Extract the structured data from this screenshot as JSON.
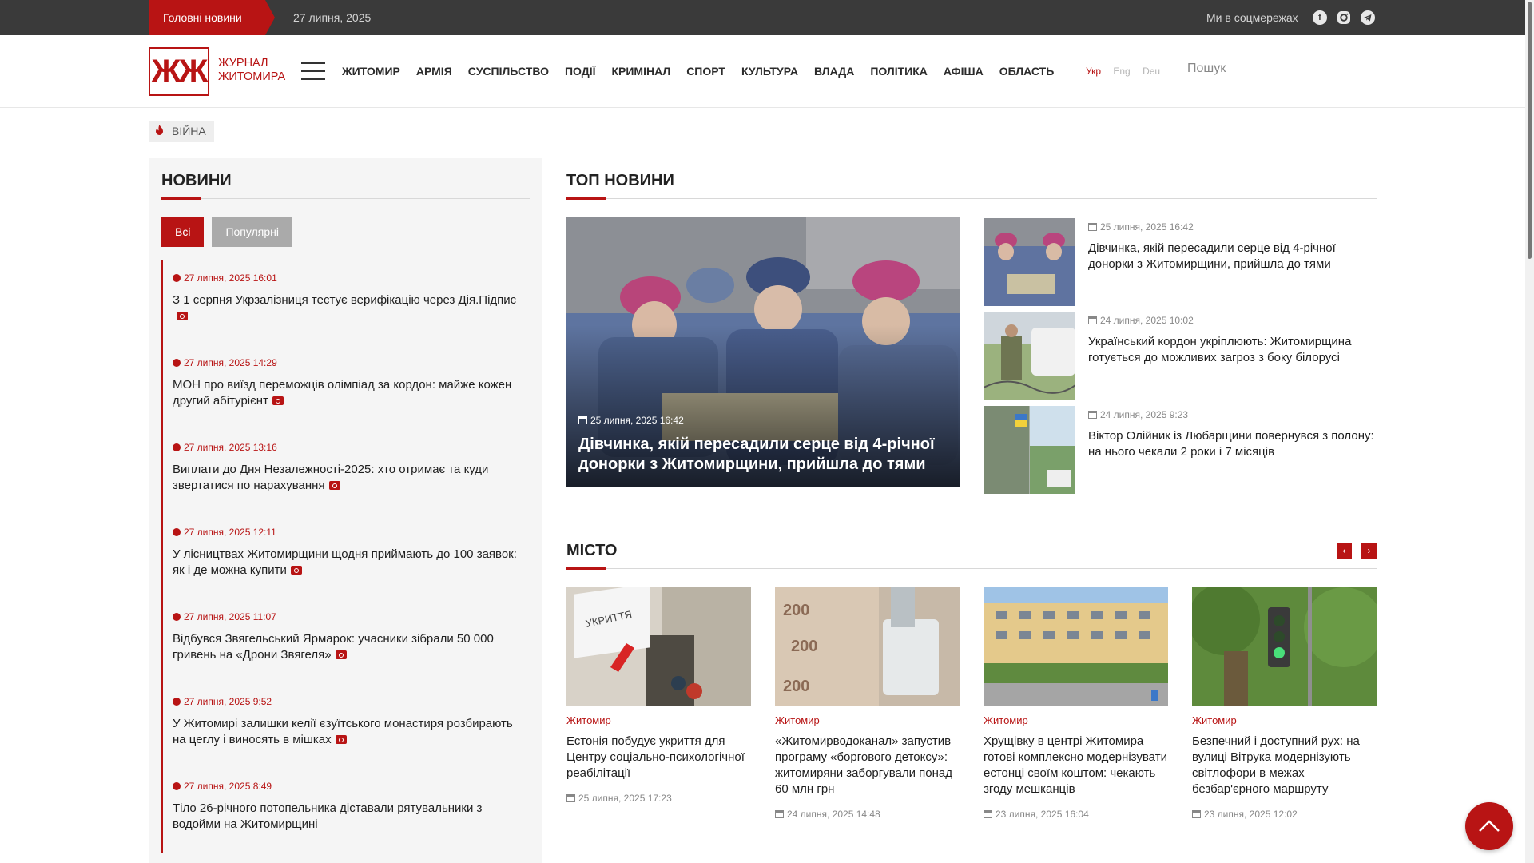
{
  "topbar": {
    "hot_label": "Головні новини",
    "date": "27 липня, 2025",
    "social_label": "Ми в соцмережах",
    "social_icons": [
      "facebook-icon",
      "instagram-icon",
      "telegram-icon"
    ]
  },
  "header": {
    "logo_mark": "ЖЖ",
    "logo_line1": "ЖУРНАЛ",
    "logo_line2": "ЖИТОМИРА",
    "nav": [
      "ЖИТОМИР",
      "АРМІЯ",
      "СУСПІЛЬСТВО",
      "ПОДІЇ",
      "КРИМІНАЛ",
      "СПОРТ",
      "КУЛЬТУРА",
      "ВЛАДА",
      "ПОЛІТИКА",
      "АФІША",
      "ОБЛАСТЬ"
    ],
    "langs": [
      "Укр",
      "Eng",
      "Deu"
    ],
    "search_placeholder": "Пошук"
  },
  "tag": {
    "label": "ВІЙНА"
  },
  "news_panel": {
    "title": "НОВИНИ",
    "tab_all": "Всі",
    "tab_popular": "Популярні",
    "items": [
      {
        "time": "27 липня, 2025 16:01",
        "title": "З 1 серпня Укрзалізниця тестує верифікацію через Дія.Підпис"
      },
      {
        "time": "27 липня, 2025 14:29",
        "title": "МОН про виїзд переможців олімпіад за кордон: майже кожен другий абітурієнт"
      },
      {
        "time": "27 липня, 2025 13:16",
        "title": "Виплати до Дня Незалежності-2025: хто отримає та куди звертатися по нарахування"
      },
      {
        "time": "27 липня, 2025 12:11",
        "title": "У лісництвах Житомирщини щодня приймають до 100 заявок: як і де можна купити"
      },
      {
        "time": "27 липня, 2025 11:07",
        "title": "Відбувся Звягельський Ярмарок: учасники зібрали 50 000 гривень на «Дрони Звягеля»"
      },
      {
        "time": "27 липня, 2025 9:52",
        "title": "У Житомирі залишки келії єзуїтського монастиря розбирають на цеглу і виносять в мішках"
      },
      {
        "time": "27 липня, 2025 8:49",
        "title": "Тіло 26-річного потопельника діставали рятувальники з водойми на Житомирщині"
      }
    ]
  },
  "top_news": {
    "title": "ТОП НОВИНИ",
    "feature": {
      "date": "25 липня, 2025 16:42",
      "title": "Дівчинка, якій пересадили серце від 4-річної донорки з Житомирщини, прийшла до тями"
    },
    "side": [
      {
        "date": "25 липня, 2025 16:42",
        "title": "Дівчинка, якій пересадили серце від 4-річної донорки з Житомирщини, прийшла до тями"
      },
      {
        "date": "24 липня, 2025 10:02",
        "title": "Український кордон укріплюють: Житомирщина готується до можливих загроз з боку білорусі"
      },
      {
        "date": "24 липня, 2025 9:23",
        "title": "Віктор Олійник із Любарщини повернувся з полону: на нього чекали 2 роки і 7 місяців"
      }
    ]
  },
  "city": {
    "title": "МІСТО",
    "cards": [
      {
        "category": "Житомир",
        "title": "Естонія побудує укриття для Центру соціально-психологічної реабілітації",
        "date": "25 липня, 2025 17:23",
        "image_text": "УКРИТТЯ"
      },
      {
        "category": "Житомир",
        "title": "«Житомирводоканал» запустив програму «боргового детоксу»: житомиряни заборгували понад 60 млн грн",
        "date": "24 липня, 2025 14:48",
        "image_text": "200"
      },
      {
        "category": "Житомир",
        "title": "Хрущівку в центрі Житомира готові комплексно модернізувати естонці своїм коштом: чекають згоду мешканців",
        "date": "23 липня, 2025 16:04"
      },
      {
        "category": "Житомир",
        "title": "Безпечний і доступний рух: на вулиці Вітрука модернізують світлофори в межах безбар'єрного маршруту",
        "date": "23 липня, 2025 12:02"
      }
    ]
  },
  "colors": {
    "accent": "#b81414",
    "topbar": "#3a3a3a",
    "panel": "#f5f5f5"
  }
}
